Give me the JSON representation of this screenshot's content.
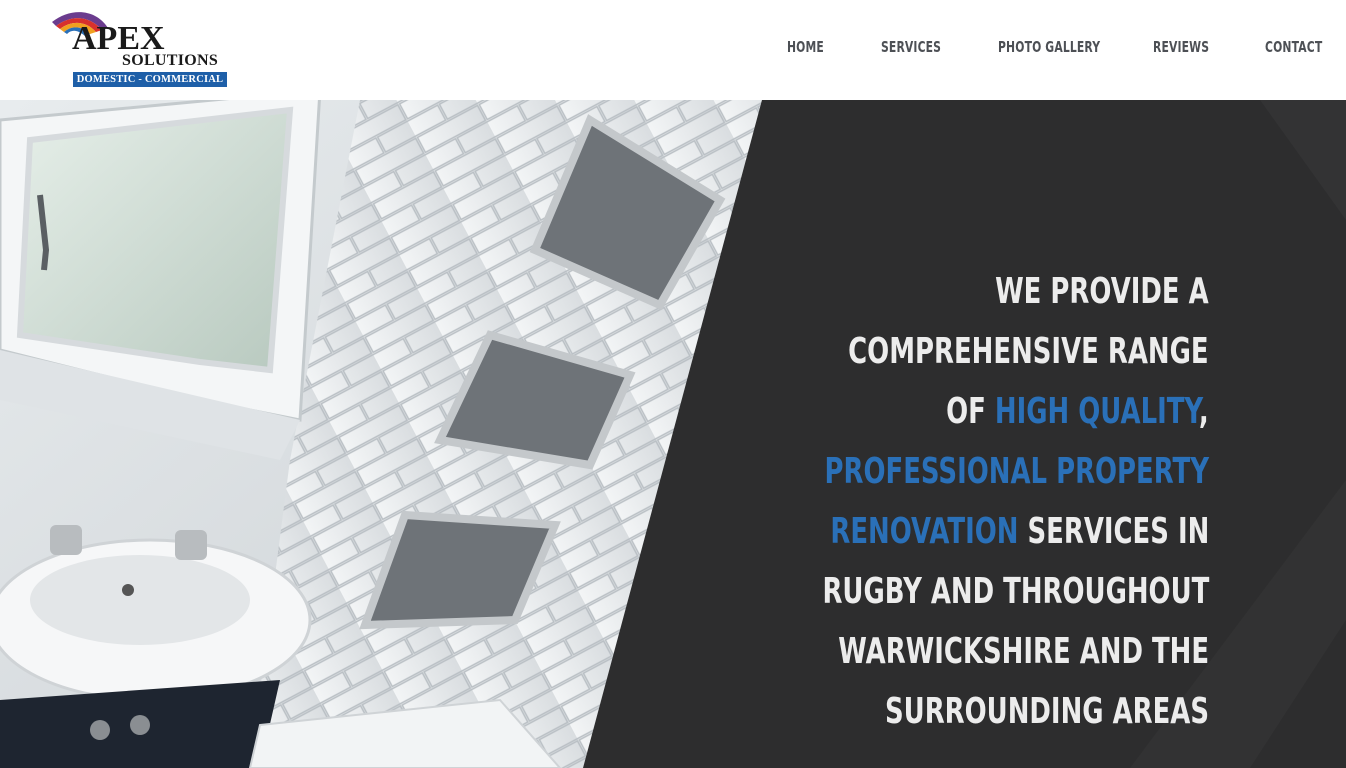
{
  "brand": {
    "name": "APEX",
    "sub": "SOLUTIONS",
    "tagline": "DOMESTIC - COMMERCIAL",
    "colors": {
      "blue": "#1e5fa8",
      "red": "#d8312c",
      "orange": "#f0a020",
      "purple": "#6b3c8e"
    }
  },
  "nav": {
    "items": [
      {
        "label": "HOME"
      },
      {
        "label": "SERVICES"
      },
      {
        "label": "PHOTO GALLERY"
      },
      {
        "label": "REVIEWS"
      },
      {
        "label": "CONTACT"
      }
    ]
  },
  "hero": {
    "line1": "WE PROVIDE A",
    "line2": "COMPREHENSIVE RANGE",
    "line3_a": "OF ",
    "line3_b": "HIGH QUALITY",
    "line3_c": ",",
    "line4": "PROFESSIONAL PROPERTY",
    "line5_a": "RENOVATION",
    "line5_b": " SERVICES IN",
    "line6": "RUGBY AND THROUGHOUT",
    "line7": "WARWICKSHIRE AND THE",
    "line8": "SURROUNDING AREAS",
    "image": "bathroom-renovation-photo",
    "colors": {
      "panel": "#2d2d2e",
      "highlight": "#2a70b8",
      "text": "#ececec"
    }
  }
}
